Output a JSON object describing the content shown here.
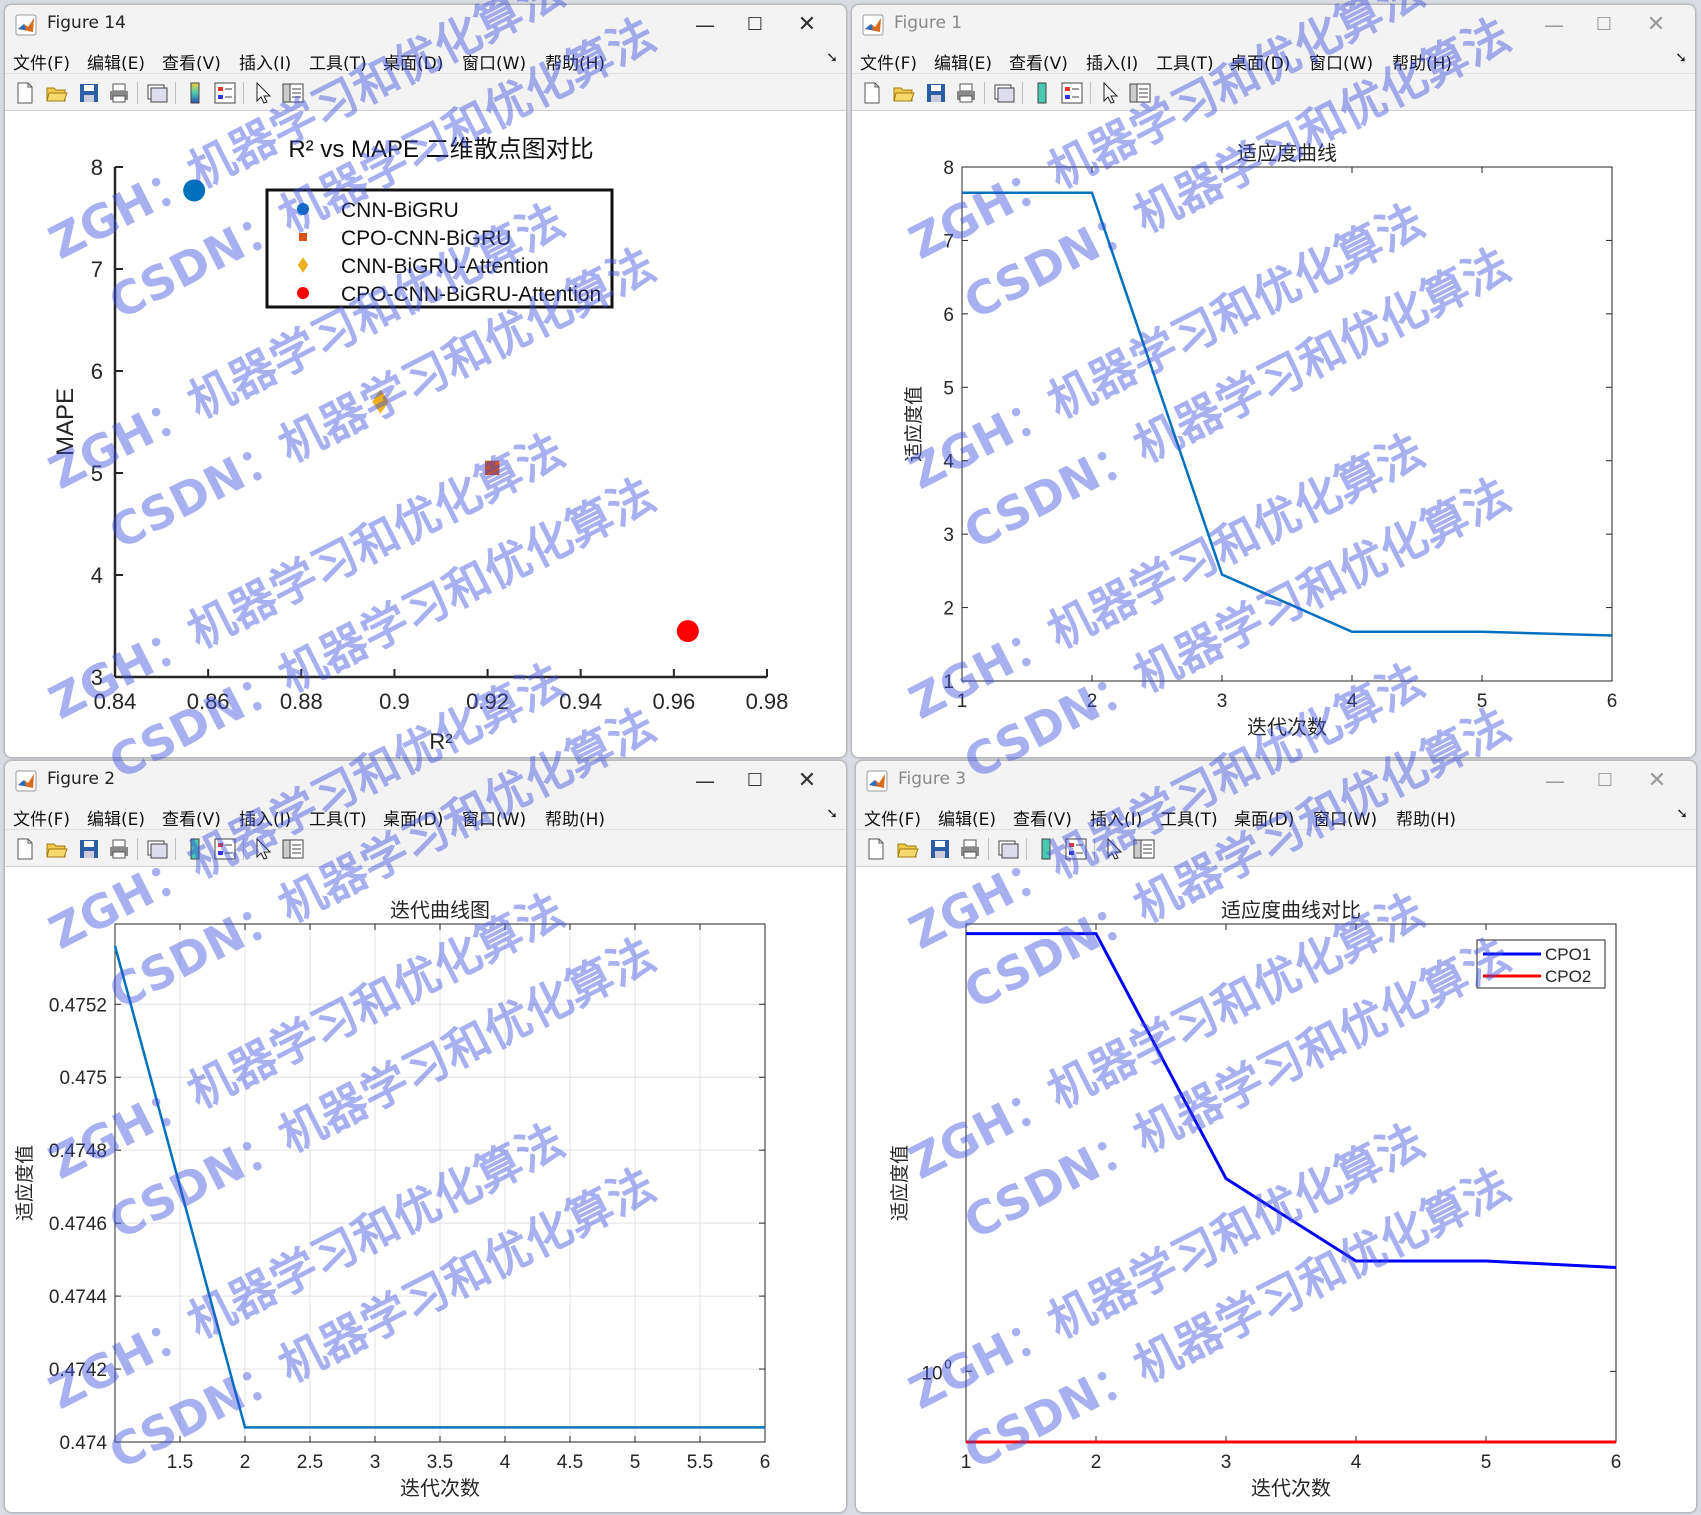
{
  "menu": [
    "文件(F)",
    "编辑(E)",
    "查看(V)",
    "插入(I)",
    "工具(T)",
    "桌面(D)",
    "窗口(W)",
    "帮助(H)"
  ],
  "windows": {
    "fig14": {
      "title": "Figure 14",
      "chart_data": {
        "type": "scatter",
        "title": "R² vs MAPE 二维散点图对比",
        "xlabel": "R²",
        "ylabel": "MAPE",
        "xlim": [
          0.84,
          0.98
        ],
        "ylim": [
          3,
          8
        ],
        "xticks": [
          "0.84",
          "0.86",
          "0.88",
          "0.9",
          "0.92",
          "0.94",
          "0.96",
          "0.98"
        ],
        "yticks": [
          "3",
          "4",
          "5",
          "6",
          "7",
          "8"
        ],
        "legend_position": "top",
        "grid": false,
        "series": [
          {
            "name": "CNN-BiGRU",
            "marker": "circle",
            "color": "#0072BD",
            "x": 0.857,
            "y": 7.77
          },
          {
            "name": "CPO-CNN-BiGRU",
            "marker": "square",
            "color": "#D95319",
            "x": 0.921,
            "y": 5.05
          },
          {
            "name": "CNN-BiGRU-Attention",
            "marker": "diamond",
            "color": "#EDB120",
            "x": 0.897,
            "y": 5.7
          },
          {
            "name": "CPO-CNN-BiGRU-Attention",
            "marker": "circle",
            "color": "#FF0000",
            "x": 0.963,
            "y": 3.45
          }
        ]
      }
    },
    "fig1": {
      "title": "Figure 1",
      "chart_data": {
        "type": "line",
        "title": "适应度曲线",
        "xlabel": "迭代次数",
        "ylabel": "适应度值",
        "xlim": [
          1,
          6
        ],
        "ylim": [
          1,
          8
        ],
        "xticks": [
          "1",
          "2",
          "3",
          "4",
          "5",
          "6"
        ],
        "yticks": [
          "1",
          "2",
          "3",
          "4",
          "5",
          "6",
          "7",
          "8"
        ],
        "grid": false,
        "series": [
          {
            "color": "#0072BD",
            "x": [
              1,
              2,
              3,
              4,
              5,
              6
            ],
            "y": [
              7.65,
              7.65,
              2.45,
              1.67,
              1.67,
              1.62
            ]
          }
        ]
      }
    },
    "fig2": {
      "title": "Figure 2",
      "chart_data": {
        "type": "line",
        "title": "迭代曲线图",
        "xlabel": "迭代次数",
        "ylabel": "适应度值",
        "xlim": [
          1,
          6
        ],
        "ylim": [
          0.474,
          0.47542
        ],
        "xticks": [
          "1.5",
          "2",
          "2.5",
          "3",
          "3.5",
          "4",
          "4.5",
          "5",
          "5.5",
          "6"
        ],
        "yticks": [
          "0.474",
          "0.4742",
          "0.4744",
          "0.4746",
          "0.4748",
          "0.475",
          "0.4752"
        ],
        "grid": true,
        "series": [
          {
            "color": "#0072BD",
            "x": [
              1,
              2,
              3,
              4,
              5,
              6
            ],
            "y": [
              0.47536,
              0.47404,
              0.47404,
              0.47404,
              0.47404,
              0.47404
            ]
          }
        ]
      }
    },
    "fig3": {
      "title": "Figure 3",
      "chart_data": {
        "type": "line",
        "title": "适应度曲线对比",
        "xlabel": "迭代次数",
        "ylabel": "适应度值",
        "xlim": [
          1,
          6
        ],
        "ylim": [
          0.72,
          8.0
        ],
        "yscale": "log",
        "xticks": [
          "1",
          "2",
          "3",
          "4",
          "5",
          "6"
        ],
        "ytick_label": {
          "base": "10",
          "exp": "0"
        },
        "legend_position": "top-right",
        "grid": false,
        "series": [
          {
            "name": "CPO1",
            "color": "#0000FF",
            "x": [
              1,
              2,
              3,
              4,
              5,
              6
            ],
            "y": [
              7.65,
              7.65,
              2.45,
              1.67,
              1.67,
              1.62
            ]
          },
          {
            "name": "CPO2",
            "color": "#FF0000",
            "x": [
              1,
              2,
              3,
              4,
              5,
              6
            ],
            "y": [
              0.72,
              0.72,
              0.72,
              0.72,
              0.72,
              0.72
            ]
          }
        ]
      }
    }
  },
  "watermark": {
    "line1": "ZGH：机器学习和优化算法",
    "line2": "CSDN：机器学习和优化算法",
    "color": "#3d4fdc"
  }
}
